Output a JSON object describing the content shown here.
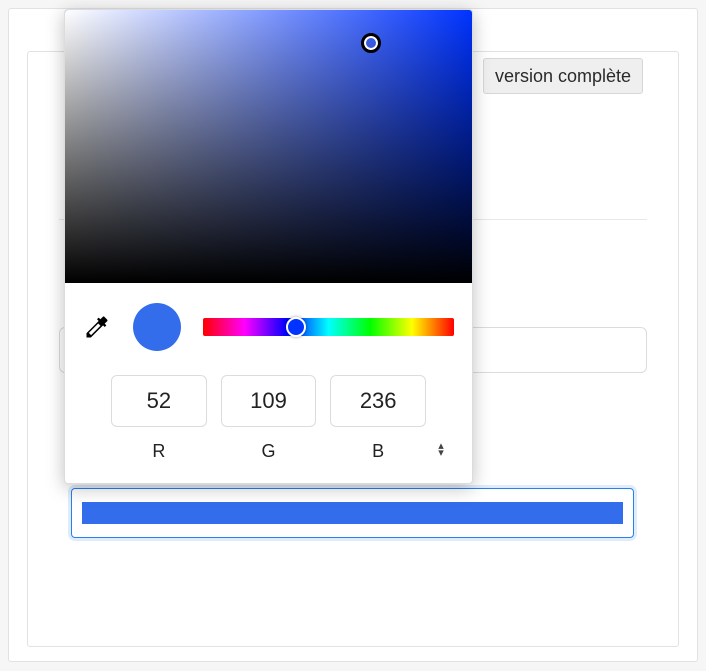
{
  "buttons": {
    "version_complete": "version complète"
  },
  "picker": {
    "hue_base": "#0033ff",
    "current_color": "#346dec",
    "rgb": {
      "r": "52",
      "g": "109",
      "b": "236"
    },
    "labels": {
      "r": "R",
      "g": "G",
      "b": "B"
    }
  },
  "swatch": {
    "color": "#346dec"
  }
}
